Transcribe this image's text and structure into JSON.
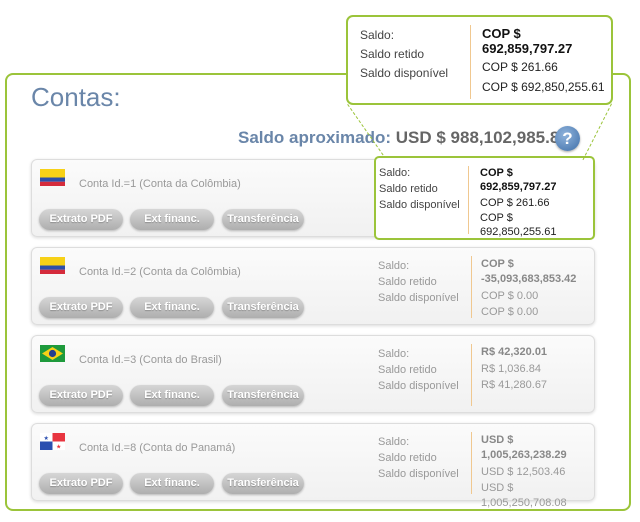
{
  "page": {
    "title": "Contas:"
  },
  "balance": {
    "label": "Saldo aproximado:",
    "value": "USD $ 988,102,985.80",
    "help_icon": "question-icon"
  },
  "colors": {
    "accent": "#9bc43a",
    "title": "#6a86a9",
    "button": "#b8b8b8"
  },
  "field_labels": {
    "saldo": "Saldo:",
    "retido": "Saldo retido",
    "disponivel": "Saldo disponível"
  },
  "buttons": {
    "extrato": "Extrato PDF",
    "ext_financ": "Ext financ.",
    "transferencia": "Transferência"
  },
  "callout": {
    "saldo": "COP $ 692,859,797.27",
    "retido": "COP $ 261.66",
    "disponivel": "COP $ 692,850,255.61"
  },
  "accounts": [
    {
      "label": "Conta Id.=1  (Conta da Colômbia)",
      "flag": "colombia-flag",
      "saldo": "COP $ 692,859,797.27",
      "retido": "COP $ 261.66",
      "disponivel": "COP $ 692,850,255.61"
    },
    {
      "label": "Conta Id.=2  (Conta da Colômbia)",
      "flag": "colombia-flag",
      "saldo": "COP $ -35,093,683,853.42",
      "retido": "COP $ 0.00",
      "disponivel": "COP $ 0.00"
    },
    {
      "label": "Conta Id.=3  (Conta do Brasil)",
      "flag": "brazil-flag",
      "saldo": "R$ 42,320.01",
      "retido": "R$ 1,036.84",
      "disponivel": "R$ 41,280.67"
    },
    {
      "label": "Conta Id.=8  (Conta do Panamá)",
      "flag": "panama-flag",
      "saldo": "USD $ 1,005,263,238.29",
      "retido": "USD $ 12,503.46",
      "disponivel": "USD $ 1,005,250,708.08"
    }
  ]
}
